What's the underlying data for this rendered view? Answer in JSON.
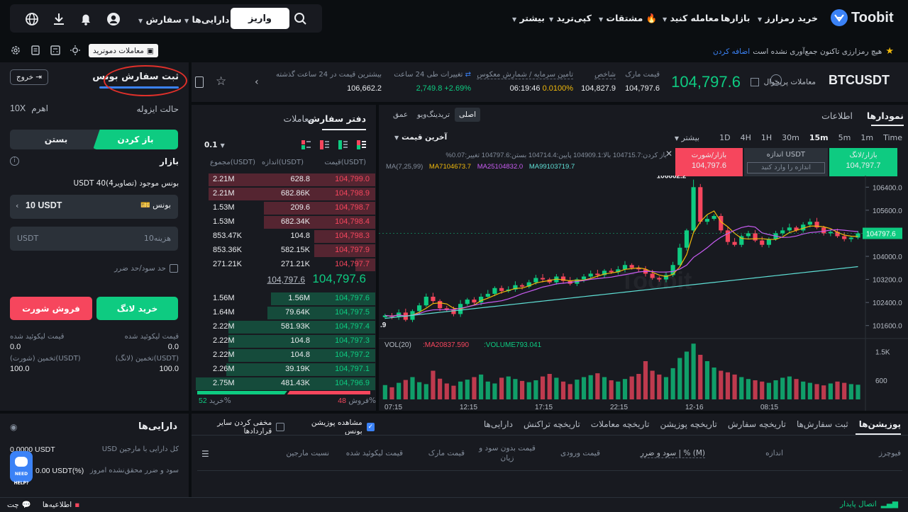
{
  "nav": {
    "brand": "Toobit",
    "links": [
      "خرید رمزارز",
      "بازارها",
      "معامله کنید",
      "مشتقات",
      "کپی‌ترید",
      "بیشتر"
    ],
    "deposit": "واریز",
    "assets": "دارایی‌ها",
    "orders": "سفارش"
  },
  "notice": {
    "text": "هیچ رمزارزی تاکنون جمع‌آوری نشده است",
    "link": "اضافه کردن",
    "demo": "معاملات دموترید"
  },
  "ticker": {
    "symbol": "BTCUSDT",
    "sub": "معاملات پرپچوال",
    "price": "104,797.6",
    "mark_label": "قیمت مارک",
    "mark_value": "104,797.6",
    "index_label": "شاخص",
    "index_value": "104,827.9",
    "funding_label": "تامین سرمایه / شمارش معکوس",
    "funding_value": "0.0100%",
    "countdown": "06:19:46",
    "change_label": "تغییرات طی 24 ساعت",
    "change_value": "+2.69%",
    "change_abs": "2,749.8",
    "high_label": "بیشترین قیمت در 24 ساعت گذشته",
    "high_value": "106,662.2"
  },
  "chart_panel": {
    "tab_charts": "نمودارها",
    "tab_info": "اطلاعات",
    "view_basic": "اصلی",
    "view_tv": "تریدینگ‌ویو",
    "view_depth": "عمق",
    "timeframes": [
      "Time",
      "1m",
      "5m",
      "15m",
      "30m",
      "1H",
      "4H",
      "1D"
    ],
    "more": "بیشتر",
    "last_price": "آخرین قیمت",
    "ohlc": "باز کردن:104715.7 بالا:104909.1 پایین:104714.4 بستن:104797.6 تغییر:0.07%",
    "ma_line": "MA(7,25,99)",
    "ma7": "MA7104673.7",
    "ma25": "MA25104832.0",
    "ma99": "MA99103719.7",
    "vol_label": "VOL(20)",
    "vol_ma": "MA20837.590",
    "vol_value": "VOLUME793.041",
    "peak_label": "106662.2",
    "low_label": ".9",
    "price_ticks": [
      "106400.0",
      "105600.0",
      "104800.0",
      "104000.0",
      "103200.0",
      "102400.0",
      "101600.0"
    ],
    "current_tag": "104797.6",
    "vol_ticks": [
      "1.5K",
      "600"
    ],
    "time_ticks": [
      "07:15",
      "12:15",
      "17:15",
      "22:15",
      "12-16",
      "08:15"
    ],
    "quick_long": "بازار/لانگ",
    "quick_long_price": "104,797.7",
    "quick_short": "بازار/شورت",
    "quick_short_price": "104,797.6",
    "size_label": "اندازه USDT",
    "size_placeholder": "اندازه را وارد کنید",
    "watermark": "Toobit"
  },
  "chart_data": {
    "type": "candlestick",
    "ylim": [
      101200,
      106800
    ],
    "peak": 106662.2,
    "last": 104797.6,
    "close_series": [
      101950,
      101900,
      102050,
      101800,
      102100,
      102300,
      102600,
      102450,
      102200,
      102150,
      102000,
      102350,
      102500,
      102400,
      102600,
      102700,
      102900,
      102800,
      102850,
      103000,
      102950,
      103100,
      103250,
      103200,
      103100,
      103300,
      103150,
      103050,
      103200,
      103300,
      103400,
      103350,
      103500,
      103450,
      103550,
      103700,
      103600,
      103550,
      103400,
      103250,
      103200,
      103350,
      103700,
      104300,
      104900,
      106400,
      105200,
      105300,
      105400,
      104900,
      104500,
      104400,
      104700,
      104800,
      104550,
      104400,
      104600,
      104800,
      104900,
      105000,
      104900,
      105100,
      105200,
      105000,
      104800,
      104850,
      104700,
      104600,
      104650,
      104797.6
    ],
    "vol_ylim": [
      0,
      2000
    ],
    "volumes": [
      450,
      380,
      520,
      610,
      700,
      540,
      480,
      900,
      650,
      500,
      430,
      560,
      620,
      700,
      780,
      560,
      500,
      680,
      720,
      640,
      580,
      540,
      600,
      720,
      800,
      680,
      560,
      480,
      620,
      700,
      760,
      820,
      700,
      600,
      560,
      640,
      720,
      800,
      1200,
      900,
      780,
      700,
      980,
      1300,
      1500,
      1750,
      1400,
      1200,
      1000,
      900,
      850,
      780,
      700,
      640,
      600,
      560,
      520,
      600,
      680,
      720,
      640,
      560,
      520,
      480,
      440,
      500,
      560,
      520,
      480,
      460
    ]
  },
  "orderbook": {
    "tab_book": "دفتر سفارش",
    "tab_trades": "معاملات",
    "step": "0.1",
    "col_price": "قیمت(USDT)",
    "col_size": "اندازه(USDT)",
    "col_total": "مجموع(USDT)",
    "asks": [
      {
        "price": "104,799.0",
        "size": "628.8",
        "total": "2.21M",
        "depth": 0.93
      },
      {
        "price": "104,798.9",
        "size": "682.86K",
        "total": "2.21M",
        "depth": 0.93
      },
      {
        "price": "104,798.7",
        "size": "209.6",
        "total": "1.53M",
        "depth": 0.62
      },
      {
        "price": "104,798.4",
        "size": "682.34K",
        "total": "1.53M",
        "depth": 0.62
      },
      {
        "price": "104,798.3",
        "size": "104.8",
        "total": "853.47K",
        "depth": 0.34
      },
      {
        "price": "104,797.9",
        "size": "582.15K",
        "total": "853.36K",
        "depth": 0.34
      },
      {
        "price": "104,797.7",
        "size": "271.21K",
        "total": "271.21K",
        "depth": 0.11
      }
    ],
    "mid_price": "104,797.6",
    "mid_mark": "104,797.6",
    "bids": [
      {
        "price": "104,797.6",
        "size": "1.56M",
        "total": "1.56M",
        "depth": 0.58
      },
      {
        "price": "104,797.5",
        "size": "79.64K",
        "total": "1.64M",
        "depth": 0.6
      },
      {
        "price": "104,797.4",
        "size": "581.93K",
        "total": "2.22M",
        "depth": 0.82
      },
      {
        "price": "104,797.3",
        "size": "104.8",
        "total": "2.22M",
        "depth": 0.82
      },
      {
        "price": "104,797.2",
        "size": "104.8",
        "total": "2.22M",
        "depth": 0.82
      },
      {
        "price": "104,797.1",
        "size": "39.19K",
        "total": "2.26M",
        "depth": 0.83
      },
      {
        "price": "104,796.9",
        "size": "481.43K",
        "total": "2.75M",
        "depth": 1.0
      }
    ],
    "buy_pct_label": "خرید%",
    "buy_pct": "52",
    "sell_pct_label": "فروش%",
    "sell_pct": "48"
  },
  "order_form": {
    "title": "ثبت سفارش بونس",
    "exit": "خروج",
    "isolated": "حالت ایزوله",
    "leverage_label": "اهرم",
    "leverage": "10X",
    "open": "باز کردن",
    "close": "بستن",
    "market": "بازار",
    "bonus_available": "بونس موجود (تصاویر4)40 USDT",
    "bonus_label": "بونس",
    "bonus_value": "10 USDT",
    "cost_placeholder": "هزینه10",
    "cost_unit": "USDT",
    "tpsl": "حد سود/حد ضرر",
    "buy_long": "خرید لانگ",
    "sell_short": "فروش شورت",
    "liq_price_label": "قیمت لیکوئید شده",
    "liq_long": "0.0",
    "liq_short": "0.0",
    "est_long_label": "تخمین (لانگ)(USDT)",
    "est_short_label": "تخمین (شورت)(USDT)",
    "est_long": "100.0",
    "est_short": "100.0"
  },
  "assets": {
    "title": "دارایی‌ها",
    "total_label": "کل دارایی با مارجین",
    "total_unit": "USD",
    "total_value": "0.0000 USDT",
    "pnl_label": "سود و ضرر محقق‌نشده امروز",
    "pnl_value": "0.00 USDT(%)"
  },
  "positions": {
    "tabs": [
      "پوزیشن‌ها",
      "ثبت سفارش‌ها",
      "تاریخچه سفارش",
      "تاریخچه پوزیشن",
      "تاریخچه معاملات",
      "تاریخچه تراکنش",
      "دارایی‌ها"
    ],
    "show_bonus": "مشاهده پوزیشن بونس",
    "hide_others": "مخفی کردن سایر قراردادها",
    "cols": [
      "فیوچرز",
      "اندازه",
      "سود و ضرر | % (M)",
      "قیمت ورودی",
      "قیمت بدون سود و زیان",
      "قیمت مارک",
      "قیمت لیکوئید شده",
      "نسبت مارجین"
    ]
  },
  "footer": {
    "status": "اتصال پایدار",
    "announcements": "اطلاعیه‌ها",
    "chat": "چت",
    "help": "NEED HELP?"
  },
  "colors": {
    "green": "#0ecb81",
    "red": "#f6465d",
    "bg": "#0b0e11",
    "panel": "#181a20",
    "annotation": "#e0302a"
  }
}
